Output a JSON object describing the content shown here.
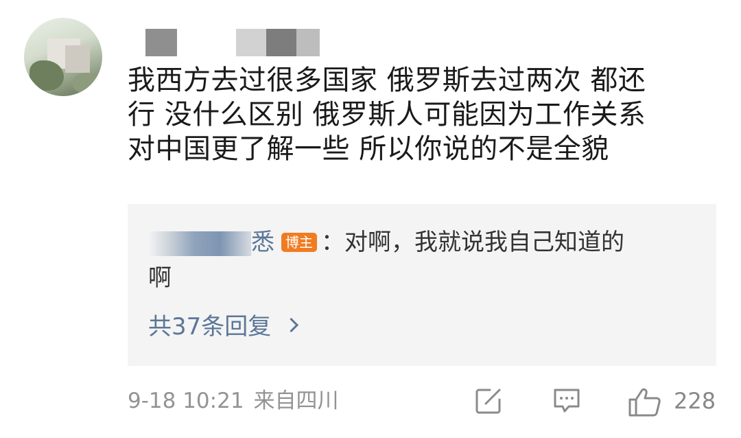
{
  "comment": {
    "lines": [
      "我西方去过很多国家 俄罗斯去过两次 都还",
      "行 没什么区别 俄罗斯人可能因为工作关系",
      "对中国更了解一些 所以你说的不是全貌"
    ]
  },
  "reply": {
    "name_visible_char": "悉",
    "badge": "博主",
    "text_line1": "：对啊，我就说我自己知道的",
    "text_line2": "啊",
    "more_replies": "共37条回复"
  },
  "meta": {
    "time": "9-18 10:21",
    "location": "来自四川"
  },
  "actions": {
    "share_icon": "share-edit-icon",
    "comment_icon": "comment-icon",
    "like_icon": "thumbs-up-icon",
    "like_count": "228"
  },
  "colors": {
    "text": "#1a1a1a",
    "link": "#5b7697",
    "badge": "#f07c22",
    "meta": "#939393",
    "reply_bg": "#f4f4f4"
  }
}
